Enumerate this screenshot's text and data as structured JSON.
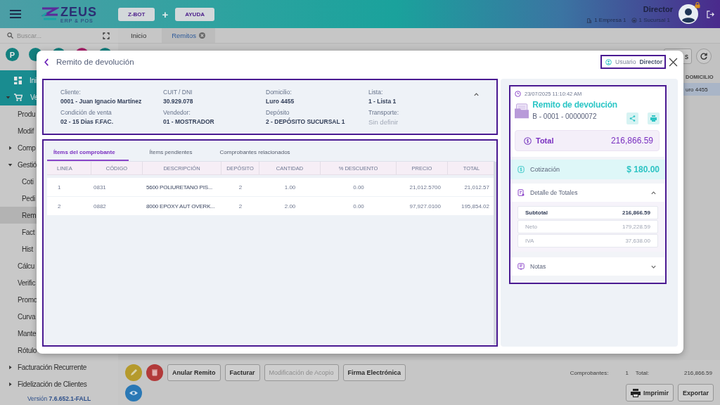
{
  "header": {
    "logo": "ZEUS",
    "logo_tagline": "ERP & POS",
    "buttons": [
      "Z-BOT",
      "AYUDA"
    ],
    "separator": "+",
    "user": {
      "name": "Director",
      "company": "1 Empresa 1",
      "branch": "1 Sucursal 1"
    }
  },
  "sidebar": {
    "search": {
      "placeholder": "Buscar..."
    },
    "shortcuts": [
      {
        "letter": "P",
        "color": "#13807f"
      },
      {
        "color": "#13807f"
      },
      {
        "color": "#13807f"
      },
      {
        "color": "#a8226a"
      },
      {
        "color": "#13807f"
      }
    ],
    "nav": [
      {
        "label": "Ini",
        "selected": false
      },
      {
        "label": "Ve",
        "expanded": true,
        "selected": false,
        "children": [
          {
            "label": "Produ",
            "selected": false
          },
          {
            "label": "Modif",
            "selected": false
          },
          {
            "label": "Comp",
            "expanded": false,
            "selected": false
          },
          {
            "label": "Gestió",
            "expanded": true,
            "selected": false,
            "children": [
              {
                "label": "Coti",
                "selected": false
              },
              {
                "label": "Pedi",
                "selected": false
              },
              {
                "label": "Rem",
                "selected": true
              },
              {
                "label": "Fact",
                "selected": false
              },
              {
                "label": "Hist",
                "selected": false
              }
            ]
          },
          {
            "label": "Cálcu",
            "selected": false
          },
          {
            "label": "Verific",
            "selected": false
          },
          {
            "label": "Promo",
            "selected": false
          },
          {
            "label": "Curva",
            "selected": false
          },
          {
            "label": "Mante",
            "selected": false
          },
          {
            "label": "Rótulo",
            "selected": false
          },
          {
            "label": "Facturación Recurrente",
            "expanded": false,
            "selected": false
          },
          {
            "label": "Fidelización de Clientes",
            "expanded": false,
            "selected": false
          }
        ]
      }
    ],
    "version": "Versión **7.6.652.1-FALL**"
  },
  "tabs": [
    {
      "label": "Inicio",
      "selected": false,
      "closable": false
    },
    {
      "label": "Remitos",
      "selected": true,
      "closable": true
    }
  ],
  "list": {
    "toolbar_button": "s",
    "columns": [
      "DOMICILIO"
    ],
    "rows": [
      {
        "cells": [
          "uro 4455"
        ],
        "selected": true
      }
    ]
  },
  "dialog": {
    "title": "Remito de devolución",
    "user": {
      "label": "Usuario",
      "value": "Director"
    },
    "info": {
      "expanded": true,
      "fields": [
        {
          "label": "Cliente:",
          "value": "0001 - Juan Ignacio Martínez",
          "empty": false
        },
        {
          "label": "CUIT / DNI",
          "value": "30.929.078",
          "empty": false
        },
        {
          "label": "Domicilio:",
          "value": "Luro 4455",
          "empty": false
        },
        {
          "label": "Lista:",
          "value": "1 - Lista 1",
          "empty": false
        },
        {
          "label": "Condición de venta",
          "value": "02 - 15 Dias F.FAC.",
          "empty": false
        },
        {
          "label": "Vendedor:",
          "value": "01 - MOSTRADOR",
          "empty": false
        },
        {
          "label": "Depósito",
          "value": "2 - DEPÓSITO SUCURSAL 1",
          "empty": false
        },
        {
          "label": "Transporte:",
          "value": "Sin definir",
          "empty": true
        }
      ]
    },
    "tabs": [
      {
        "label": "Ítems del comprobante",
        "selected": true
      },
      {
        "label": "Ítems pendientes",
        "selected": false
      },
      {
        "label": "Comprobantes relacionados",
        "selected": false
      }
    ],
    "table": {
      "columns": [
        "LINEA",
        "CÓDIGO",
        "DESCRIPCIÓN",
        "DEPÓSITO",
        "CANTIDAD",
        "% DESCUENTO",
        "PRECIO",
        "TOTAL"
      ],
      "rows": [
        [
          "1",
          "0831",
          "5600 POLIURETANO PIS...",
          "2",
          "1.00",
          "0.00",
          "21,012.5700",
          "21,012.57"
        ],
        [
          "2",
          "0882",
          "8000 EPOXY AUT OVERK...",
          "2",
          "2.00",
          "0.00",
          "97,927.0100",
          "195,854.02"
        ]
      ]
    },
    "summary": {
      "timestamp": "23/07/2025 11:10:42 AM",
      "title": "Remito de devolución",
      "number": "B - 0001 - 00000072",
      "total": {
        "label": "Total",
        "value": "216,866.59"
      },
      "rate": {
        "label": "Cotización",
        "value": "$ 180.00"
      },
      "details": {
        "title": "Detalle de Totales",
        "expanded": true,
        "rows": [
          {
            "label": "Subtotal",
            "value": "216,866.59",
            "kind": "subtotal"
          },
          {
            "label": "Neto",
            "value": "179,228.59",
            "kind": "line"
          },
          {
            "label": "IVA",
            "value": "37,638.00",
            "kind": "line"
          }
        ]
      },
      "notes": {
        "title": "Notas",
        "expanded": false
      }
    }
  },
  "footer": {
    "actions": [
      {
        "label": "Anular Remito",
        "disabled": false
      },
      {
        "label": "Facturar",
        "disabled": false
      },
      {
        "label": "Modificación de Acopio",
        "disabled": true
      },
      {
        "label": "Firma Electrónica",
        "disabled": false
      }
    ],
    "summary": {
      "count_label": "Comprobantes:",
      "count": "1",
      "total_label": "Total:",
      "total": "216,866.59"
    },
    "print": "Imprimir",
    "export": "Exportar"
  }
}
